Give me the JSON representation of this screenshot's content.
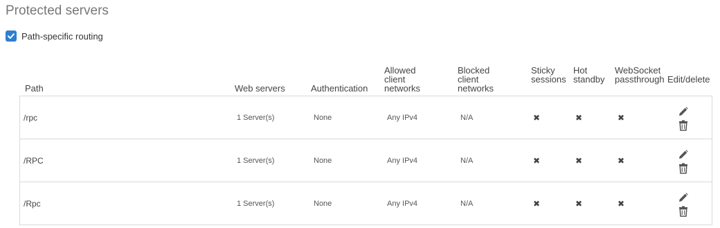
{
  "page": {
    "title": "Protected servers"
  },
  "routing": {
    "label": "Path-specific routing",
    "checked": true
  },
  "columns": {
    "path": "Path",
    "web_servers": "Web servers",
    "authentication": "Authentication",
    "allowed": [
      "Allowed",
      "client",
      "networks"
    ],
    "blocked": [
      "Blocked",
      "client",
      "networks"
    ],
    "sticky": [
      "Sticky",
      "sessions"
    ],
    "hot": [
      "Hot",
      "standby"
    ],
    "websocket": [
      "WebSocket",
      "passthrough"
    ],
    "edit": "Edit/delete"
  },
  "rows": [
    {
      "path": "/rpc",
      "web_servers": "1 Server(s)",
      "authentication": "None",
      "allowed": "Any IPv4",
      "blocked": "N/A",
      "sticky": "✖",
      "hot": "✖",
      "websocket": "✖"
    },
    {
      "path": "/RPC",
      "web_servers": "1 Server(s)",
      "authentication": "None",
      "allowed": "Any IPv4",
      "blocked": "N/A",
      "sticky": "✖",
      "hot": "✖",
      "websocket": "✖"
    },
    {
      "path": "/Rpc",
      "web_servers": "1 Server(s)",
      "authentication": "None",
      "allowed": "Any IPv4",
      "blocked": "N/A",
      "sticky": "✖",
      "hot": "✖",
      "websocket": "✖"
    }
  ],
  "icons": {
    "edit": "pencil-icon",
    "delete": "trash-icon",
    "check": "checkmark-icon"
  },
  "colors": {
    "checkbox": "#2d7fd1",
    "border": "#d9d9d9",
    "title": "#777777"
  }
}
